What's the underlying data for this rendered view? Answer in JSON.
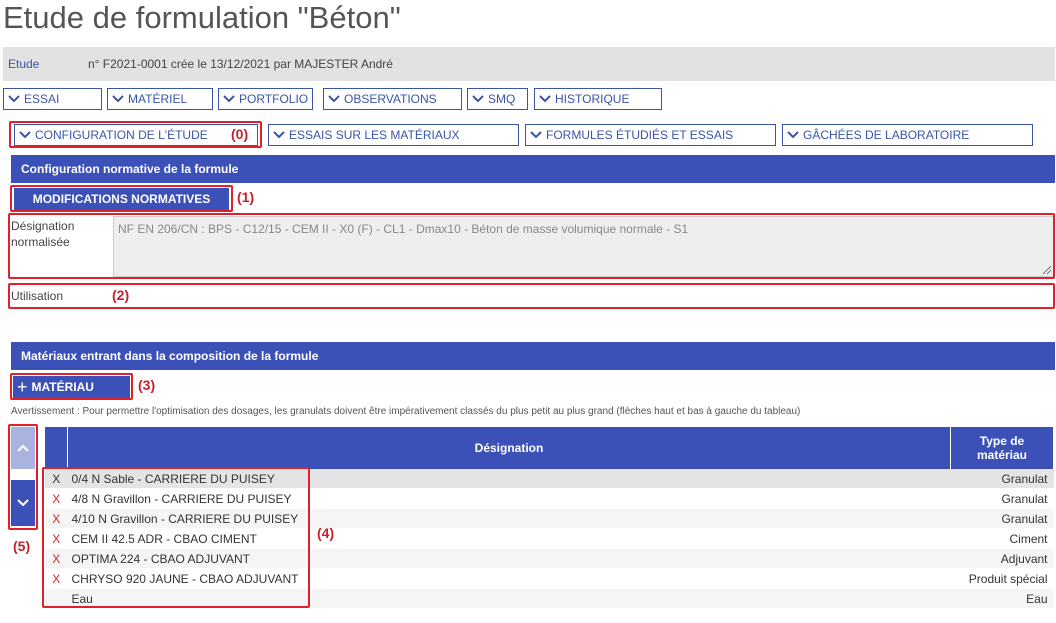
{
  "page": {
    "title": "Etude de formulation \"Béton\""
  },
  "etude": {
    "link": "Etude",
    "info": "n° F2021-0001 crée le 13/12/2021 par MAJESTER André"
  },
  "top_tabs": [
    "ESSAI",
    "MATÉRIEL",
    "PORTFOLIO",
    "OBSERVATIONS",
    "SMQ",
    "HISTORIQUE"
  ],
  "sub_tabs": [
    "CONFIGURATION DE L'ÉTUDE",
    "ESSAIS SUR LES MATÉRIAUX",
    "FORMULES ÉTUDIÉS ET ESSAIS",
    "GÂCHÉES DE LABORATOIRE"
  ],
  "config": {
    "header": "Configuration normative de la formule",
    "mod_button": "MODIFICATIONS NORMATIVES",
    "designation_label_1": "Désignation",
    "designation_label_2": "normalisée",
    "designation_value": "NF EN 206/CN : BPS - C12/15 - CEM II - X0 (F) - CL1 - Dmax10 - Béton de masse volumique normale - S1",
    "utilisation_label": "Utilisation"
  },
  "materials": {
    "header": "Matériaux entrant dans la composition de la formule",
    "add_button": "MATÉRIAU",
    "add_symbol": "+",
    "warning": "Avertissement : Pour permettre l'optimisation des dosages, les granulats doivent être impérativement classés du plus petit au plus grand (flèches haut et bas à gauche du tableau)",
    "col_designation": "Désignation",
    "col_type_1": "Type de",
    "col_type_2": "matériau",
    "delete_symbol": "X",
    "rows": [
      {
        "designation": "0/4 N Sable - CARRIERE DU PUISEY",
        "type": "Granulat",
        "deletable": true
      },
      {
        "designation": "4/8 N Gravillon - CARRIERE DU PUISEY",
        "type": "Granulat",
        "deletable": true
      },
      {
        "designation": "4/10 N Gravillon - CARRIERE DU PUISEY",
        "type": "Granulat",
        "deletable": true
      },
      {
        "designation": "CEM II 42.5 ADR - CBAO CIMENT",
        "type": "Ciment",
        "deletable": true
      },
      {
        "designation": "OPTIMA 224 - CBAO ADJUVANT",
        "type": "Adjuvant",
        "deletable": true
      },
      {
        "designation": "CHRYSO 920 JAUNE - CBAO ADJUVANT",
        "type": "Produit spécial",
        "deletable": true
      },
      {
        "designation": "Eau",
        "type": "Eau",
        "deletable": false
      }
    ]
  },
  "annotations": {
    "a0": "(0)",
    "a1": "(1)",
    "a2": "(2)",
    "a3": "(3)",
    "a4": "(4)",
    "a5": "(5)"
  },
  "colors": {
    "primary": "#3c51b8",
    "annotation": "#e0202a",
    "link": "#3a55a8"
  }
}
